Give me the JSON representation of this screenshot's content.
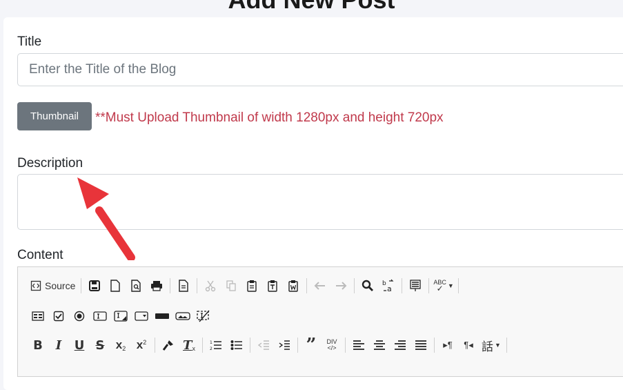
{
  "header": {
    "title": "Add New Post"
  },
  "form": {
    "title_label": "Title",
    "title_placeholder": "Enter the Title of the Blog",
    "thumbnail_button": "Thumbnail",
    "thumbnail_note": "**Must Upload Thumbnail of width 1280px and height 720px",
    "description_label": "Description",
    "content_label": "Content"
  },
  "editor": {
    "source_label": "Source",
    "row1_icons": [
      "source-icon",
      "save-icon",
      "new-page-icon",
      "preview-icon",
      "print-icon",
      "templates-icon",
      "cut-icon",
      "copy-icon",
      "paste-icon",
      "paste-text-icon",
      "paste-word-icon",
      "undo-icon",
      "redo-icon",
      "find-icon",
      "replace-icon",
      "select-all-icon",
      "spellcheck-icon"
    ],
    "row2_icons": [
      "form-icon",
      "checkbox-icon",
      "radio-icon",
      "text-field-icon",
      "textarea-icon",
      "select-icon",
      "button-icon",
      "image-button-icon",
      "hidden-field-icon"
    ],
    "row3_icons": [
      "bold-icon",
      "italic-icon",
      "underline-icon",
      "strike-icon",
      "subscript-icon",
      "superscript-icon",
      "copy-format-icon",
      "remove-format-icon",
      "numbered-list-icon",
      "bulleted-list-icon",
      "outdent-icon",
      "indent-icon",
      "blockquote-icon",
      "div-icon",
      "align-left-icon",
      "align-center-icon",
      "align-right-icon",
      "justify-icon",
      "ltr-icon",
      "rtl-icon",
      "language-icon"
    ],
    "spellcheck_label": "ABC",
    "div_label": "DIV"
  },
  "colors": {
    "accent_red": "#c0394b",
    "button_gray": "#6c757d",
    "annotation_arrow": "#e8343a"
  }
}
